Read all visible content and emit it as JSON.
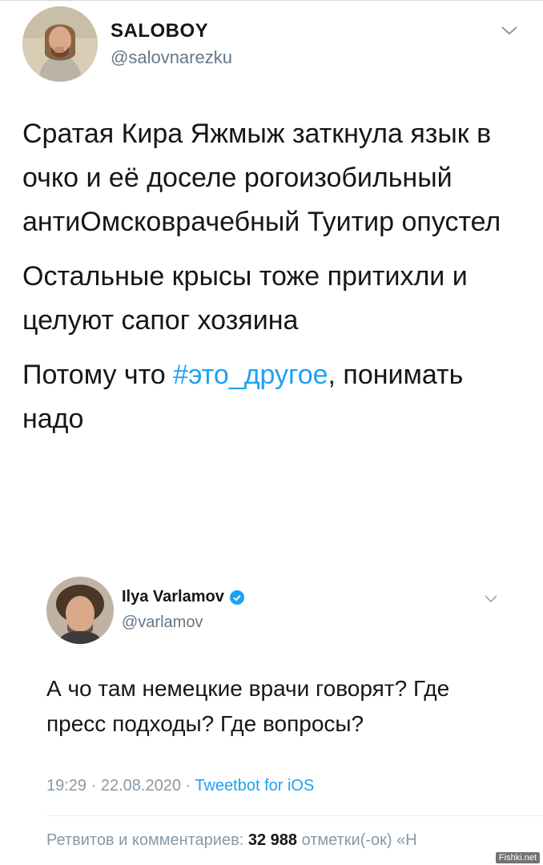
{
  "main_tweet": {
    "display_name": "SALOBOY",
    "handle": "@salovnarezku",
    "paragraphs": [
      "Сратая Кира Яжмыж заткнула язык в очко и её доселе рогоизобильный антиОмсковрачебный Туитир опустел",
      "Остальные крысы тоже притихли и целуют сапог хозяина"
    ],
    "last_paragraph_prefix": "Потому что ",
    "hashtag": "#это_другое",
    "last_paragraph_suffix": ", понимать надо"
  },
  "quoted_tweet": {
    "display_name": "Ilya Varlamov",
    "handle": "@varlamov",
    "text": "А чо там немецкие врачи говорят? Где пресс подходы? Где вопросы?",
    "time": "19:29",
    "date": "22.08.2020",
    "separator": " · ",
    "client": "Tweetbot for iOS",
    "stats_prefix": "Ретвитов и комментариев: ",
    "retweets": "32",
    "likes": "988",
    "stats_suffix": " отметки(-ок) «Н"
  },
  "watermark": "Fishki.net",
  "colors": {
    "link": "#1da1f2",
    "secondary_text": "#657786",
    "primary_text": "#14171a"
  },
  "icons": {
    "main_chevron": "chevron-down-icon",
    "quote_chevron": "chevron-down-icon",
    "verified": "verified-badge-icon"
  }
}
